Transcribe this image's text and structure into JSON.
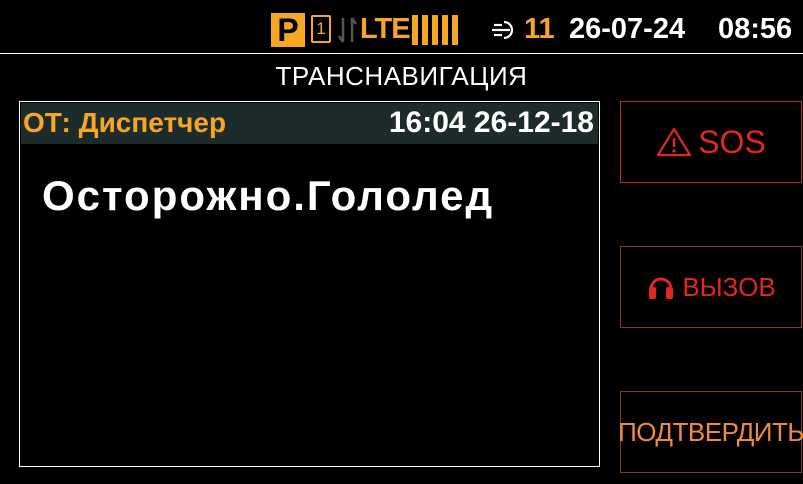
{
  "status_bar": {
    "parking_label": "P",
    "sim_slot": "1",
    "network_type": "LTE",
    "signal_level": 5,
    "satellite_count": "11",
    "date": "26-07-24",
    "time": "08:56",
    "accent_color": "#f5a623",
    "icons": [
      "parking-icon",
      "sim-icon",
      "data-arrows-icon",
      "signal-bars-icon",
      "satellite-icon"
    ]
  },
  "header": {
    "title": "ТРАНСНАВИГАЦИЯ"
  },
  "message": {
    "from": "ОТ: Диспетчер",
    "datetime": "16:04 26-12-18",
    "text": "Осторожно.Гололед"
  },
  "buttons": {
    "sos_label": "SOS",
    "sos_icon": "warning-triangle-icon",
    "call_label": "ВЫЗОВ",
    "call_icon": "headset-icon",
    "confirm_label": "ПОДТВЕРДИТЬ"
  },
  "colors": {
    "background": "#000000",
    "accent": "#f5a623",
    "alert": "#e0281e",
    "confirm": "#f08a3c",
    "header_bg": "#1e2b2b"
  }
}
